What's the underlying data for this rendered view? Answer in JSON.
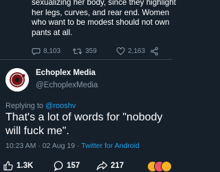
{
  "previous_tweet": {
    "lines": [
      "sexualizing her body, since they highlight",
      "her legs, curves, and rear end. Women",
      "who want to be modest should not own",
      "pants at all."
    ],
    "reply_count": "8,103",
    "retweet_count": "359",
    "like_count": "2,163"
  },
  "reply_tweet": {
    "display_name": "Echoplex Media",
    "handle": "@EchoplexMedia",
    "replying_prefix": "Replying to ",
    "replying_to": "@rooshv",
    "text_lines": [
      "That's a lot of words for \"nobody",
      "will fuck me\"."
    ],
    "time": "10:23 AM",
    "date": "02 Aug 19",
    "separator": "·",
    "source": "Twitter for Android"
  },
  "bottom_bar": {
    "likes": "1.3K",
    "comments": "157",
    "shares": "217"
  },
  "icons": {
    "reply": "speech-bubble-icon",
    "retweet": "retweet-icon",
    "like": "heart-icon",
    "share": "share-icon",
    "thumbs_up": "thumbs-up-icon",
    "comment": "comment-bubble-icon",
    "forward": "forward-arrow-icon",
    "reactions": "reaction-emoji-stack"
  },
  "colors": {
    "background": "#15202b",
    "text_primary": "#ffffff",
    "text_secondary": "#8899a6",
    "link": "#1da1f2",
    "divider": "#38444d"
  }
}
